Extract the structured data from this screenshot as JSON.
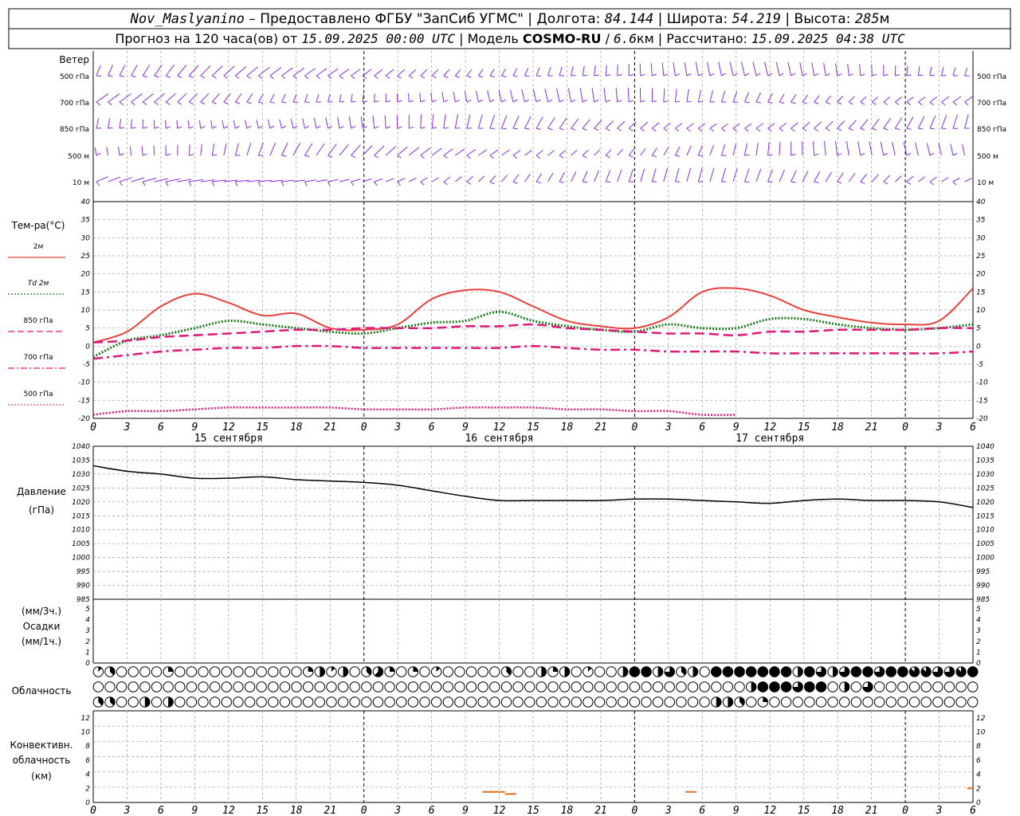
{
  "header": {
    "line1": [
      {
        "text": "Nov_Maslyanino",
        "italic": true
      },
      {
        "text": " – Предоставлено ФГБУ \"ЗапСиб УГМС\" | Долгота: ",
        "italic": false
      },
      {
        "text": "84.144",
        "italic": true
      },
      {
        "text": " | Широта: ",
        "italic": false
      },
      {
        "text": "54.219",
        "italic": true
      },
      {
        "text": " | Высота: ",
        "italic": false
      },
      {
        "text": "285",
        "italic": true
      },
      {
        "text": "м",
        "italic": false
      }
    ],
    "line2": [
      {
        "text": "Прогноз на 120 часа(ов) от ",
        "italic": false
      },
      {
        "text": "15.09.2025 00:00 UTC",
        "italic": true
      },
      {
        "text": " | Модель ",
        "italic": false
      },
      {
        "text": "COSMO-RU",
        "italic": false,
        "bold": true
      },
      {
        "text": " / ",
        "italic": false
      },
      {
        "text": "6.6",
        "italic": true
      },
      {
        "text": "км | Рассчитано: ",
        "italic": false
      },
      {
        "text": "15.09.2025 04:38 UTC",
        "italic": true
      }
    ]
  },
  "x_ticks": [
    "0",
    "3",
    "6",
    "9",
    "12",
    "15",
    "18",
    "21",
    "0",
    "3",
    "6",
    "9",
    "12",
    "15",
    "18",
    "21",
    "0",
    "3",
    "6",
    "9",
    "12",
    "15",
    "18",
    "21",
    "0",
    "3",
    "6"
  ],
  "day_labels": [
    "15 сентября",
    "16 сентября",
    "17 сентября"
  ],
  "colors": {
    "wind": "#8a2be2",
    "t2m": "#e8413c",
    "td2m": "#1e7b1e",
    "t850": "#e0177a",
    "t700": "#e0177a",
    "t500": "#e0177a",
    "pressure": "#000000",
    "convective": "#e07020",
    "grid": "#999999"
  },
  "wind_panel": {
    "title": "Ветер",
    "levels": [
      "500 гПа",
      "700 гПа",
      "850 гПа",
      "500 м",
      "10  м"
    ]
  },
  "temp_panel": {
    "title": "Тем-ра(°С)",
    "legend": [
      {
        "label": "2м",
        "style": "solid"
      },
      {
        "label": "Td  2м",
        "style": "dotted"
      },
      {
        "label": "850 гПа",
        "style": "dashed"
      },
      {
        "label": "700 гПа",
        "style": "dashdot"
      },
      {
        "label": "500 гПа",
        "style": "dotted-fine"
      }
    ],
    "ticks": [
      "40",
      "35",
      "30",
      "25",
      "20",
      "15",
      "10",
      "5",
      "0",
      "-5",
      "-10",
      "-15",
      "-20"
    ]
  },
  "pressure_panel": {
    "title": "Давление",
    "unit": "(гПа)",
    "ticks": [
      "1040",
      "1035",
      "1030",
      "1025",
      "1020",
      "1015",
      "1010",
      "1005",
      "1000",
      "995",
      "990",
      "985"
    ]
  },
  "precip_panel": {
    "unit1": "(мм/3ч.)",
    "title": "Осадки",
    "unit2": "(мм/1ч.)",
    "ticks": [
      "5",
      "4",
      "3",
      "2",
      "1",
      "0"
    ]
  },
  "cloud_panel": {
    "title": "Облачность"
  },
  "conv_panel": {
    "title1": "Конвективн.",
    "title2": "облачность",
    "unit": "(км)",
    "ticks": [
      "12",
      "10",
      "8",
      "6",
      "4",
      "2",
      "0"
    ]
  },
  "chart_data": [
    {
      "type": "line",
      "title": "Тем-ра(°С)",
      "xlabel": "",
      "ylabel": "Тем-ра(°С)",
      "x_hours": [
        0,
        3,
        6,
        9,
        12,
        15,
        18,
        21,
        24,
        27,
        30,
        33,
        36,
        39,
        42,
        45,
        48,
        51,
        54,
        57,
        60,
        63,
        66,
        69,
        72,
        75,
        78
      ],
      "ylim": [
        -20,
        40
      ],
      "series": [
        {
          "name": "2м",
          "values": [
            1,
            4,
            11,
            14.5,
            12,
            8.5,
            9,
            5,
            4.5,
            6,
            13,
            15.5,
            15,
            11,
            7,
            5.5,
            5,
            8,
            15,
            16,
            14,
            10,
            8,
            6.5,
            6,
            7,
            16
          ]
        },
        {
          "name": "Td  2м",
          "values": [
            -3,
            1.5,
            3,
            5,
            7,
            6,
            5,
            4,
            3.5,
            5,
            6.5,
            7,
            9.5,
            7,
            5.5,
            4.5,
            4,
            6,
            5,
            5,
            7.5,
            7.5,
            6,
            5,
            4.5,
            5,
            6
          ]
        },
        {
          "name": "850 гПа",
          "values": [
            1,
            1.5,
            2.5,
            3,
            3.5,
            4,
            4.5,
            4.5,
            5,
            5,
            5,
            5.5,
            5.5,
            6,
            5,
            4.5,
            4,
            3.5,
            3.5,
            3,
            4,
            4,
            4.5,
            4.5,
            4.5,
            5,
            5
          ]
        },
        {
          "name": "700 гПа",
          "values": [
            -3.5,
            -2.5,
            -1.5,
            -1,
            -0.5,
            -0.5,
            0,
            0,
            -0.5,
            -0.5,
            -0.5,
            -0.5,
            -0.5,
            0,
            -0.5,
            -1,
            -1,
            -1.5,
            -1.5,
            -1.5,
            -2,
            -2,
            -2,
            -2,
            -2,
            -2,
            -1.5
          ]
        },
        {
          "name": "500 гПа",
          "values": [
            -19,
            -18,
            -18,
            -17.5,
            -17,
            -17,
            -17,
            -17,
            -17.5,
            -17.5,
            -17.5,
            -17,
            -17,
            -17,
            -17.5,
            -17.5,
            -18,
            -18,
            -19,
            -19,
            -20.5,
            -21,
            -21,
            -21,
            -21,
            -21,
            -21
          ]
        }
      ]
    },
    {
      "type": "line",
      "title": "Давление",
      "ylabel": "(гПа)",
      "x_hours": [
        0,
        3,
        6,
        9,
        12,
        15,
        18,
        21,
        24,
        27,
        30,
        33,
        36,
        39,
        42,
        45,
        48,
        51,
        54,
        57,
        60,
        63,
        66,
        69,
        72,
        75,
        78
      ],
      "ylim": [
        985,
        1040
      ],
      "series": [
        {
          "name": "Давление",
          "values": [
            1033,
            1031,
            1030,
            1028.5,
            1028.5,
            1029,
            1028,
            1027.5,
            1027,
            1026,
            1024,
            1022,
            1020.5,
            1020.5,
            1020.5,
            1020.5,
            1021,
            1021,
            1020.5,
            1020,
            1019.5,
            1020.5,
            1021,
            1020.5,
            1020.5,
            1020,
            1018
          ]
        }
      ]
    },
    {
      "type": "bar",
      "title": "Осадки",
      "ylabel": "(мм/3ч.)",
      "ylim": [
        0,
        5
      ],
      "x_hours": [],
      "values": []
    },
    {
      "type": "table",
      "title": "Облачность",
      "rows": [
        "upper",
        "middle",
        "lower"
      ],
      "fraction_steps": 8,
      "upper": [
        1,
        3,
        0,
        0,
        0,
        0,
        2,
        0,
        0,
        0,
        0,
        0,
        0,
        0,
        0,
        0,
        0,
        0,
        2,
        4,
        1,
        4,
        0,
        3,
        5,
        2,
        0,
        2,
        0,
        1,
        0,
        0,
        0,
        0,
        0,
        3,
        0,
        0,
        4,
        2,
        4,
        0,
        1,
        0,
        0,
        4,
        8,
        8,
        4,
        6,
        3,
        4,
        0,
        8,
        8,
        8,
        8,
        8,
        8,
        8,
        4,
        8,
        6,
        4,
        6,
        8,
        8,
        6,
        8,
        8,
        7,
        7,
        6,
        6,
        7,
        8
      ],
      "middle": [
        0,
        0,
        0,
        0,
        0,
        0,
        0,
        0,
        0,
        0,
        0,
        0,
        0,
        0,
        0,
        0,
        0,
        0,
        0,
        0,
        0,
        0,
        0,
        0,
        0,
        0,
        0,
        0,
        0,
        0,
        0,
        0,
        0,
        0,
        0,
        0,
        0,
        0,
        0,
        0,
        0,
        0,
        0,
        0,
        0,
        0,
        0,
        0,
        0,
        0,
        0,
        0,
        0,
        0,
        0,
        0,
        0,
        0,
        0,
        0,
        0,
        0,
        0,
        0,
        0,
        0,
        0,
        0,
        0,
        0,
        0,
        0,
        0,
        0,
        0,
        0
      ],
      "middle_spot": [
        0,
        0,
        0,
        0,
        0,
        0,
        0,
        0,
        0,
        0,
        0,
        0,
        0,
        0,
        0,
        0,
        0,
        0,
        0,
        0,
        0,
        0,
        0,
        0,
        0,
        0,
        0,
        0,
        0,
        0,
        0,
        0,
        0,
        0,
        0,
        0,
        0,
        0,
        0,
        0,
        0,
        0,
        0,
        0,
        0,
        0,
        0,
        0,
        0,
        0,
        0,
        0,
        0,
        0,
        0,
        0,
        0,
        0,
        0,
        0,
        0,
        0,
        0,
        0,
        0,
        0,
        0,
        0,
        0,
        0,
        0,
        0,
        0,
        0,
        0,
        0
      ],
      "lower": [
        3,
        3,
        0,
        0,
        4,
        0,
        4,
        0,
        0,
        0,
        0,
        0,
        0,
        0,
        0,
        0,
        0,
        0,
        0,
        0,
        0,
        0,
        0,
        0,
        0,
        0,
        0,
        0,
        0,
        0,
        0,
        0,
        0,
        0,
        0,
        0,
        0,
        0,
        0,
        0,
        0,
        0,
        0,
        0,
        0,
        0,
        0,
        0,
        0,
        0,
        0,
        0,
        0,
        0,
        0,
        0,
        0,
        0,
        0,
        0,
        0,
        0,
        0,
        0,
        0,
        0,
        0,
        0,
        0,
        0,
        0,
        0,
        0,
        0,
        0,
        0
      ]
    },
    {
      "type": "bar",
      "title": "Конвективн. облачность",
      "ylabel": "(км)",
      "ylim": [
        0,
        13
      ],
      "segments": [
        {
          "x_start": 34.5,
          "x_end": 36.5,
          "y": 1.5
        },
        {
          "x_start": 36.5,
          "x_end": 37.5,
          "y": 1.2
        },
        {
          "x_start": 52.5,
          "x_end": 53.5,
          "y": 1.5
        },
        {
          "x_start": 77.5,
          "x_end": 78,
          "y": 2
        }
      ]
    }
  ]
}
